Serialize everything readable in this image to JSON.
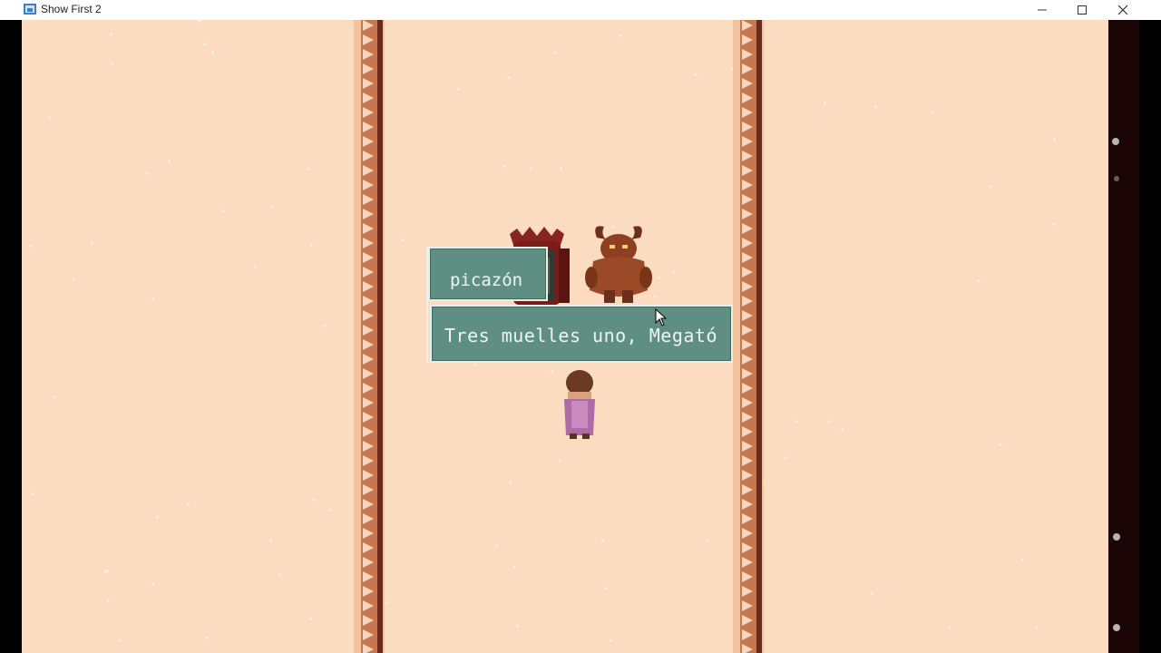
{
  "window": {
    "title": "Show First 2",
    "controls": {
      "minimize": "minimize-icon",
      "maximize": "maximize-icon",
      "close": "close-icon"
    }
  },
  "scene": {
    "background_color": "#fcdcc1",
    "wall_color": "#c7774f",
    "characters": [
      "armored-knight",
      "horned-demon",
      "hero"
    ]
  },
  "dialog": {
    "speaker": "picazón",
    "message": "Tres muelles uno, Megató"
  }
}
